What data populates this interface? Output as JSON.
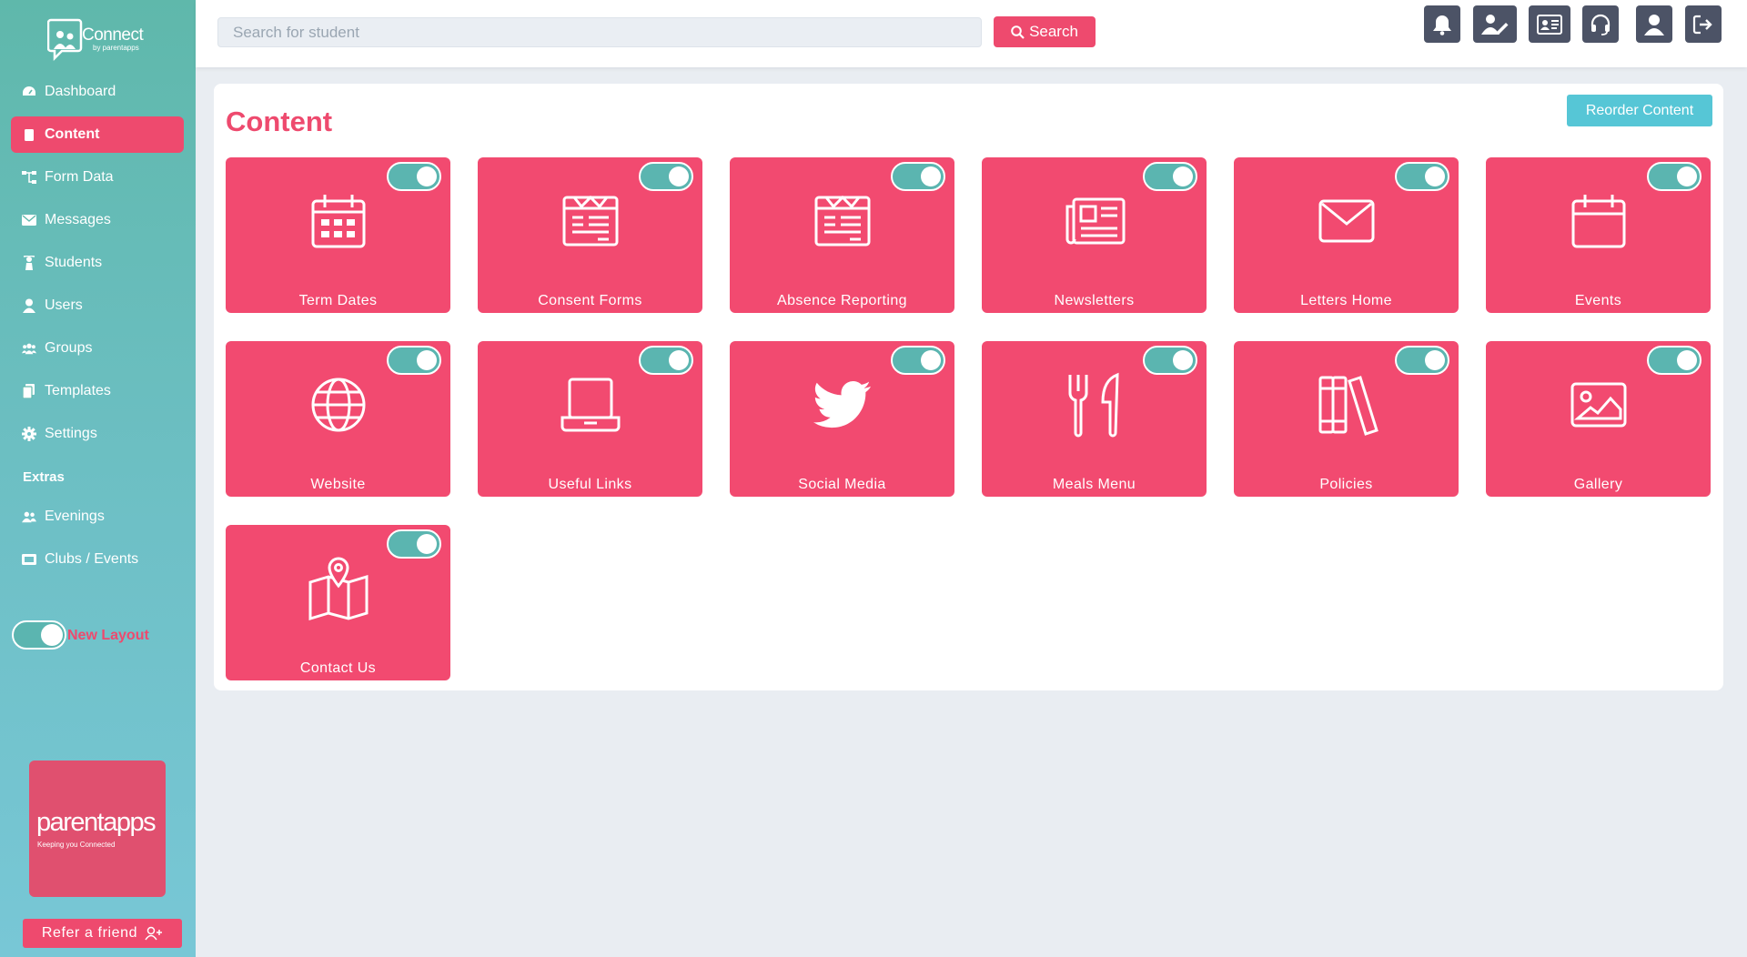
{
  "app": {
    "logo_word": "Connect",
    "logo_sub": "by parentapps"
  },
  "sidebar": {
    "items": [
      {
        "label": "Dashboard",
        "icon": "dashboard-icon"
      },
      {
        "label": "Content",
        "icon": "file-icon",
        "active": true
      },
      {
        "label": "Form Data",
        "icon": "sitemap-icon"
      },
      {
        "label": "Messages",
        "icon": "envelope-icon"
      },
      {
        "label": "Students",
        "icon": "student-icon"
      },
      {
        "label": "Users",
        "icon": "user-icon"
      },
      {
        "label": "Groups",
        "icon": "users-icon"
      },
      {
        "label": "Templates",
        "icon": "copy-icon"
      },
      {
        "label": "Settings",
        "icon": "gear-icon"
      }
    ],
    "extras_heading": "Extras",
    "extras": [
      {
        "label": "Evenings",
        "icon": "users-icon"
      },
      {
        "label": "Clubs / Events",
        "icon": "ticket-icon"
      }
    ],
    "layout_toggle_label": "New Layout",
    "layout_toggle_on": true,
    "promo_word": "parentapps",
    "promo_sub": "Keeping you Connected",
    "refer_label": "Refer a friend"
  },
  "topbar": {
    "search_placeholder": "Search for student",
    "search_value": "",
    "search_button": "Search",
    "icons": [
      "bell-icon",
      "user-edit-icon",
      "id-card-icon",
      "headset-icon",
      "user-icon",
      "sign-out-icon"
    ]
  },
  "content": {
    "title": "Content",
    "reorder_label": "Reorder Content",
    "tiles": [
      {
        "label": "Term Dates",
        "icon": "calendar-grid-icon",
        "enabled": true
      },
      {
        "label": "Consent Forms",
        "icon": "newspaper-form-icon",
        "enabled": true
      },
      {
        "label": "Absence Reporting",
        "icon": "newspaper-form-icon",
        "enabled": true
      },
      {
        "label": "Newsletters",
        "icon": "newspaper-icon",
        "enabled": true
      },
      {
        "label": "Letters Home",
        "icon": "envelope-icon",
        "enabled": true
      },
      {
        "label": "Events",
        "icon": "calendar-icon",
        "enabled": true
      },
      {
        "label": "Website",
        "icon": "globe-icon",
        "enabled": true
      },
      {
        "label": "Useful Links",
        "icon": "laptop-icon",
        "enabled": true
      },
      {
        "label": "Social Media",
        "icon": "twitter-icon",
        "enabled": true
      },
      {
        "label": "Meals Menu",
        "icon": "utensils-icon",
        "enabled": true
      },
      {
        "label": "Policies",
        "icon": "books-icon",
        "enabled": true
      },
      {
        "label": "Gallery",
        "icon": "image-icon",
        "enabled": true
      },
      {
        "label": "Contact Us",
        "icon": "map-marker-icon",
        "enabled": true
      }
    ]
  },
  "colors": {
    "sidebar_teal": "#5fb8ab",
    "accent_pink": "#ee4a6e",
    "tile_pink": "#f24a70",
    "toggle_teal": "#5bb5b0",
    "reorder_cyan": "#56c6d6",
    "topbar_icon_bg": "#4c5366"
  }
}
